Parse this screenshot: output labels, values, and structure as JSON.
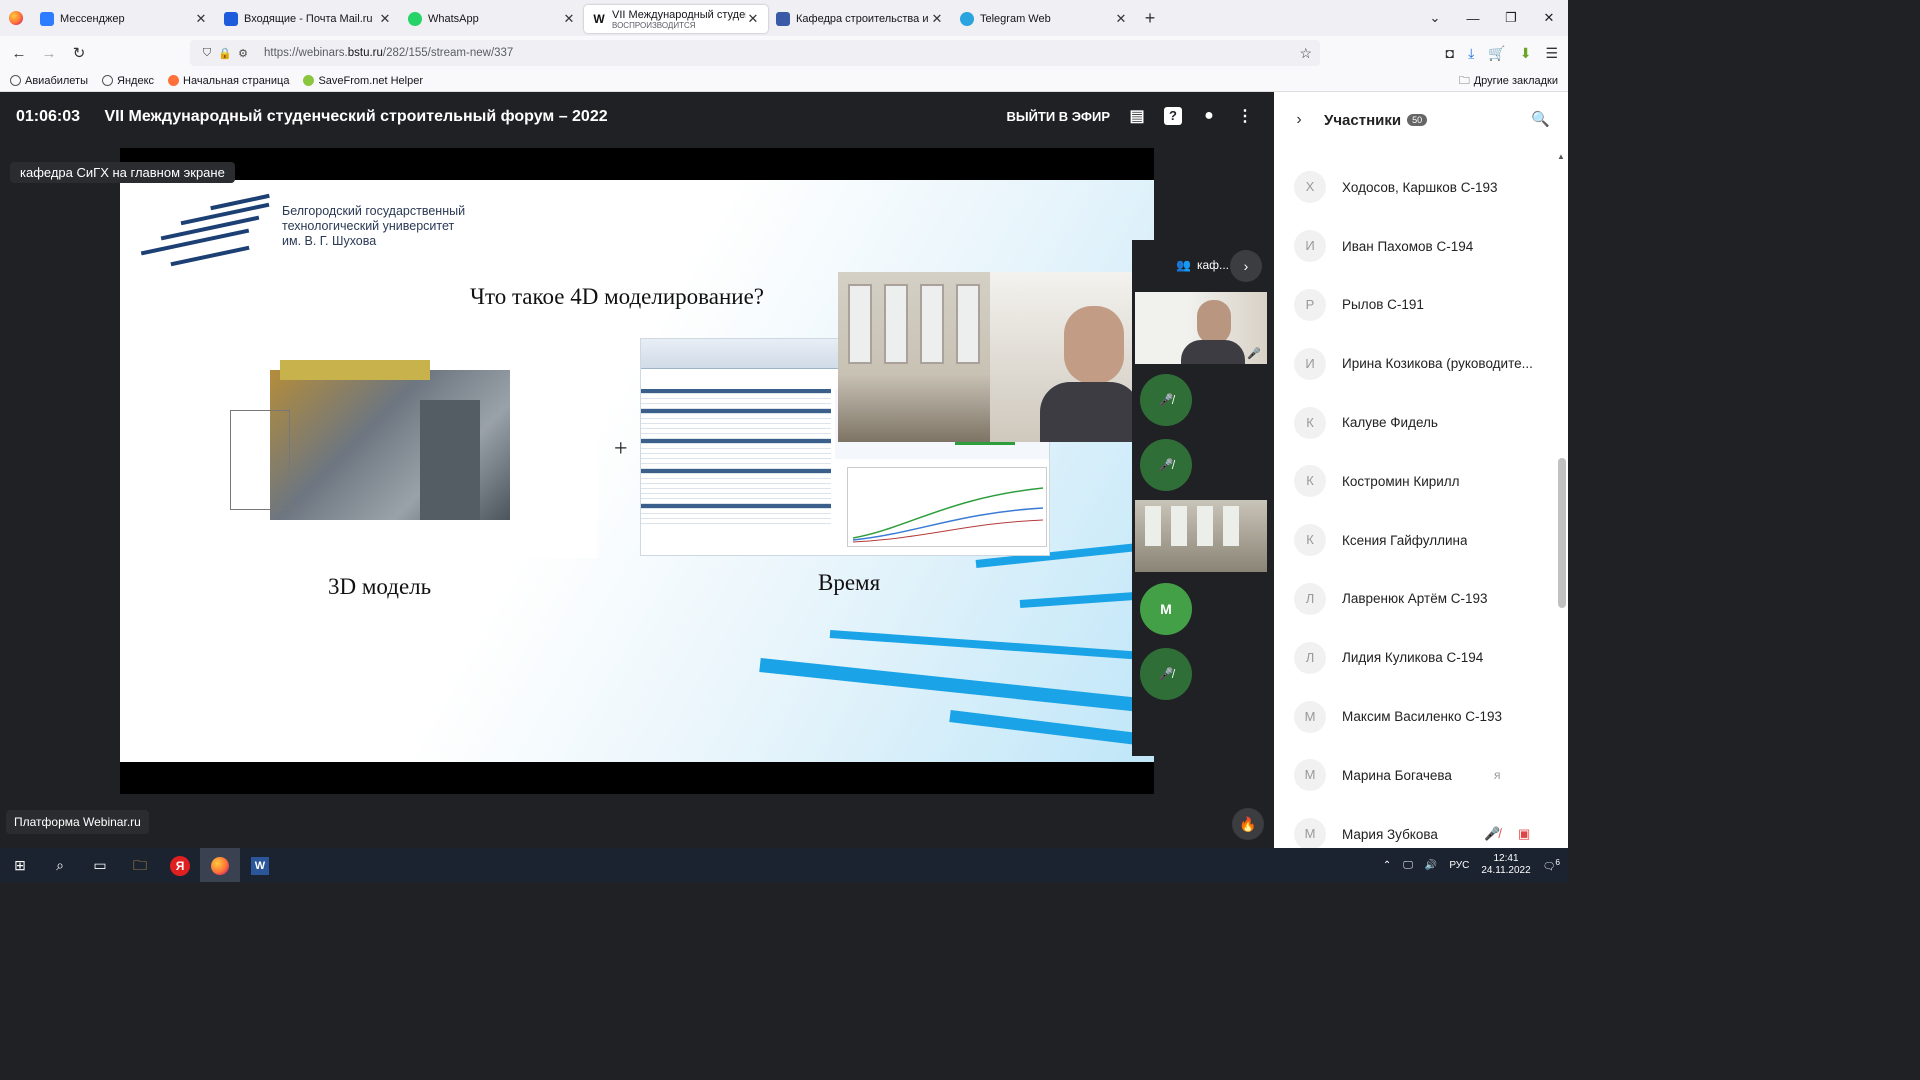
{
  "browser": {
    "tabs": [
      {
        "label": "Мессенджер",
        "color": "#2b7cff",
        "active": false
      },
      {
        "label": "Входящие - Почта Mail.ru",
        "color": "#1d5bdb",
        "active": false
      },
      {
        "label": "WhatsApp",
        "color": "#25d366",
        "active": false
      },
      {
        "label": "VII Международный студенческий",
        "sub": "ВОСПРОИЗВОДИТСЯ",
        "color": "#222222",
        "active": true
      },
      {
        "label": "Кафедра строительства и городского",
        "color": "#3a5aa8",
        "active": false
      },
      {
        "label": "Telegram Web",
        "color": "#2aa3df",
        "active": false
      }
    ],
    "url_prefix": "https://webinars.",
    "url_host": "bstu.ru",
    "url_path": "/282/155/stream-new/337",
    "bookmarks": [
      "Авиабилеты",
      "Яндекс",
      "Начальная страница",
      "SaveFrom.net Helper"
    ],
    "other_bookmarks": "Другие закладки"
  },
  "webinar": {
    "timer": "01:06:03",
    "title": "VII Международный студенческий строительный форум – 2022",
    "exit_label": "ВЫЙТИ В ЭФИР",
    "main_screen_label": "кафедра СиГХ на главном экране",
    "platform_label": "Платформа Webinar.ru",
    "strip_label": "каф...",
    "slide": {
      "uni_line1": "Белгородский государственный",
      "uni_line2": "технологический университет",
      "uni_line3": "им. В. Г. Шухова",
      "title": "Что такое 4D моделирование?",
      "plus": "+",
      "label_3d": "3D модель",
      "label_time": "Время"
    },
    "strip_avatar_letter": "М"
  },
  "participants": {
    "title": "Участники",
    "count": "50",
    "list": [
      {
        "initial": "Х",
        "name": "Ходосов, Каршков С-193"
      },
      {
        "initial": "И",
        "name": "Иван Пахомов С-194"
      },
      {
        "initial": "Р",
        "name": "Рылов С-191"
      },
      {
        "initial": "И",
        "name": "Ирина Козикова (руководите..."
      },
      {
        "initial": "К",
        "name": "Калуве Фидель"
      },
      {
        "initial": "К",
        "name": "Костромин Кирилл"
      },
      {
        "initial": "К",
        "name": "Ксения Гайфуллина"
      },
      {
        "initial": "Л",
        "name": "Лавренюк Артём С-193"
      },
      {
        "initial": "Л",
        "name": "Лидия Куликова С-194"
      },
      {
        "initial": "М",
        "name": "Максим Василенко С-193"
      },
      {
        "initial": "М",
        "name": "Марина Богачева",
        "badge": "я"
      },
      {
        "initial": "М",
        "name": "Мария Зубкова"
      }
    ]
  },
  "taskbar": {
    "lang": "РУС",
    "time": "12:41",
    "date": "24.11.2022",
    "notif": "6"
  }
}
